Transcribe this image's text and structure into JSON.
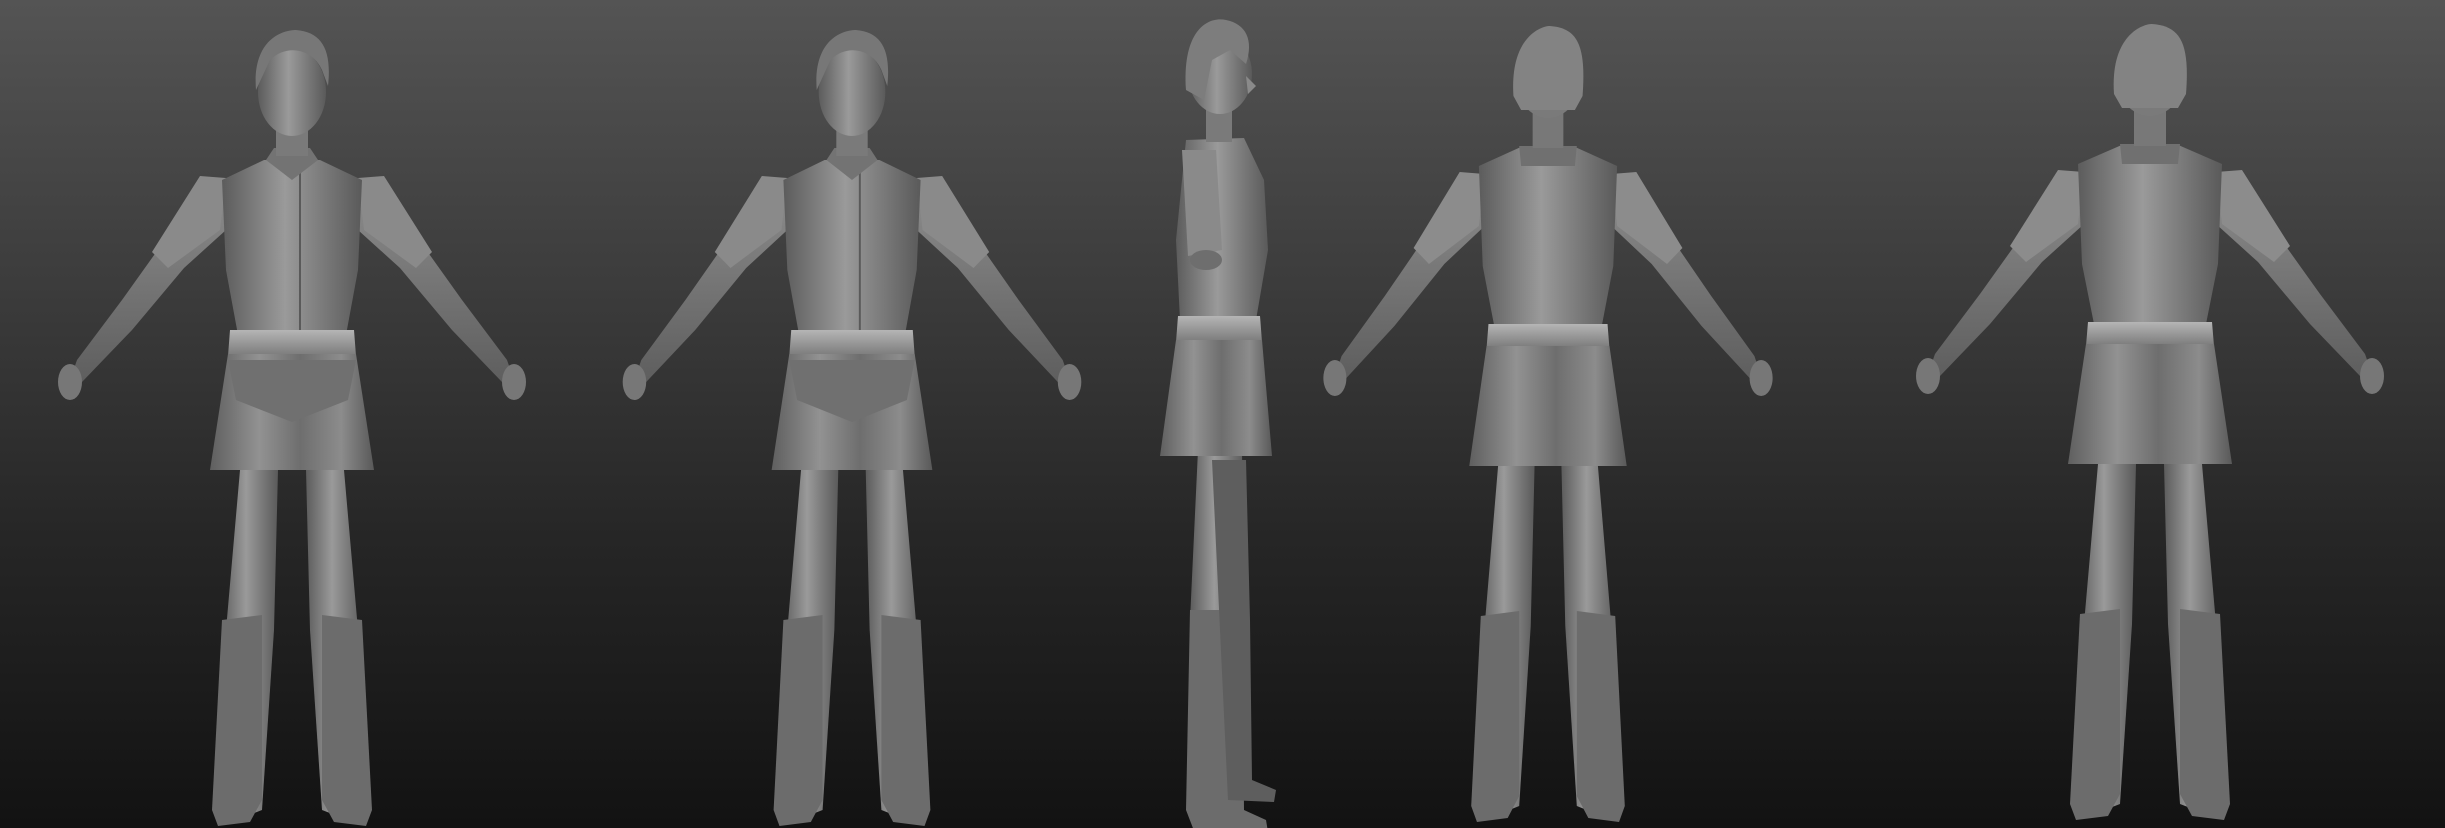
{
  "scene": {
    "views": [
      {
        "name": "front"
      },
      {
        "name": "three-quarter-front"
      },
      {
        "name": "side"
      },
      {
        "name": "three-quarter-back"
      },
      {
        "name": "back"
      }
    ],
    "colors": {
      "background_top": "#545454",
      "background_bottom": "#121212",
      "clay_base": "#7d7d7d",
      "clay_light": "#a3a3a3",
      "clay_shadow": "#555555"
    }
  }
}
